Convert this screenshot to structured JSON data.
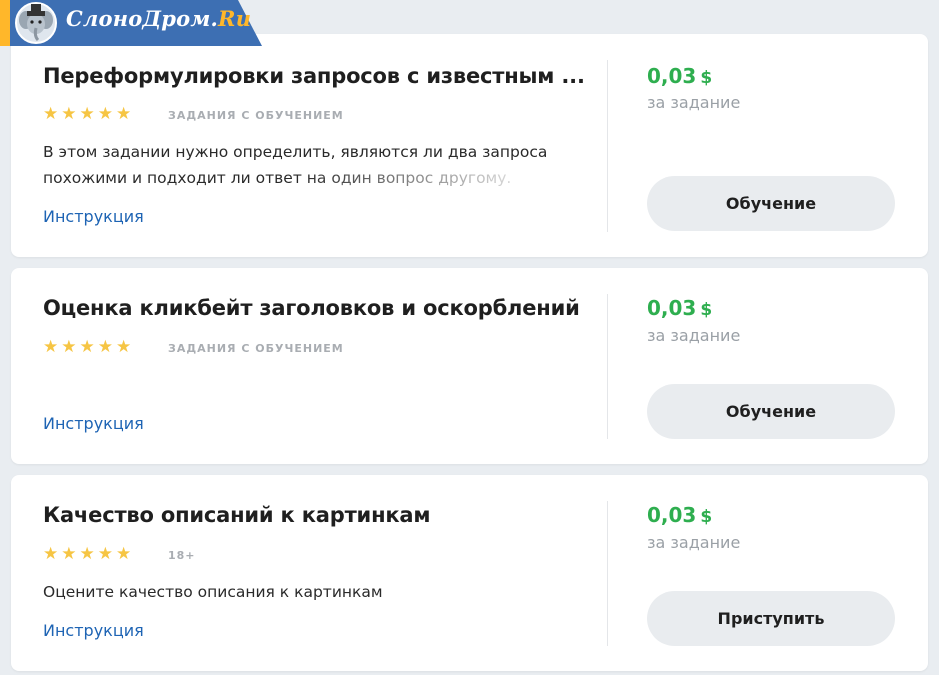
{
  "logo": {
    "text_main": "СлоноДром.",
    "text_suffix": "Ru",
    "icon": "elephant-mascot-icon"
  },
  "colors": {
    "price_green": "#2eae4f",
    "link_blue": "#1e64b4",
    "star_yellow": "#f6c544",
    "logo_blue": "#3d6fb3",
    "logo_accent": "#ffb72a"
  },
  "tasks": [
    {
      "title": "Переформулировки запросов с известным ...",
      "stars": "★★★★★",
      "badge": "задания с обучением",
      "description_line1": "В этом задании нужно определить, являются ли два запроса",
      "description_line2": "похожими и подходит ли ответ на один вопрос другому.",
      "link": "Инструкция",
      "price": "0,03",
      "currency": "$",
      "per": "за задание",
      "button": "Обучение"
    },
    {
      "title": "Оценка кликбейт заголовков и оскорблений",
      "stars": "★★★★★",
      "badge": "задания с обучением",
      "link": "Инструкция",
      "price": "0,03",
      "currency": "$",
      "per": "за задание",
      "button": "Обучение"
    },
    {
      "title": "Качество описаний к картинкам",
      "stars": "★★★★★",
      "badge": "18+",
      "description_line1": "Оцените качество описания к картинкам",
      "link": "Инструкция",
      "price": "0,03",
      "currency": "$",
      "per": "за задание",
      "button": "Приступить"
    }
  ]
}
